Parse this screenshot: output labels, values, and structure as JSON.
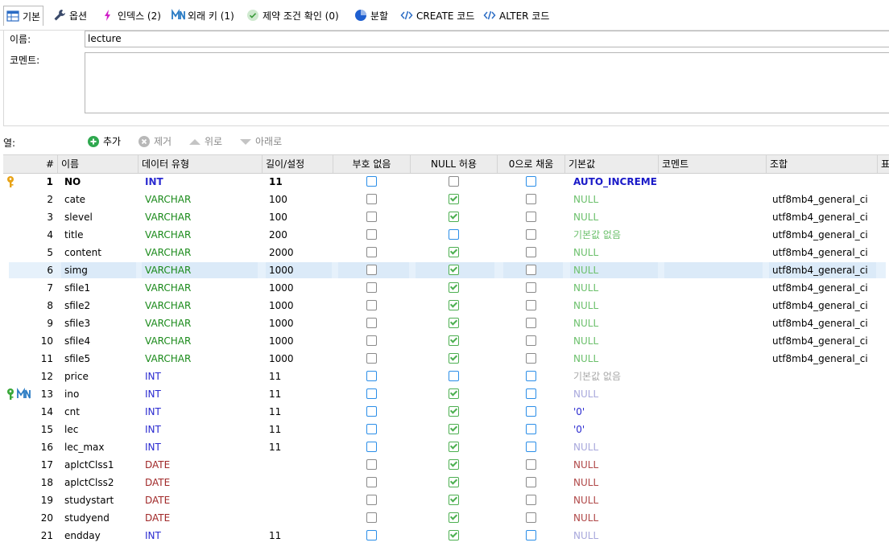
{
  "tabs": [
    {
      "label": "기본",
      "icon": "table-icon",
      "active": true
    },
    {
      "label": "옵션",
      "icon": "wrench-icon"
    },
    {
      "label": "인덱스 (2)",
      "icon": "lightning-icon"
    },
    {
      "label": "외래 키 (1)",
      "icon": "foreign-key-icon"
    },
    {
      "label": "제약 조건 확인 (0)",
      "icon": "check-circle-icon"
    },
    {
      "label": "분할",
      "icon": "pie-icon"
    },
    {
      "label": "CREATE 코드",
      "icon": "code-icon"
    },
    {
      "label": "ALTER 코드",
      "icon": "code-icon"
    }
  ],
  "form": {
    "name_label": "이름:",
    "name_value": "lecture",
    "comment_label": "코멘트:",
    "comment_value": ""
  },
  "columns_bar": {
    "label": "열:",
    "add": "추가",
    "remove": "제거",
    "up": "위로",
    "down": "아래로"
  },
  "headers": [
    "#",
    "이름",
    "데이터 유형",
    "길이/설정",
    "부호 없음",
    "NULL 허용",
    "0으로 채움",
    "기본값",
    "코멘트",
    "조합",
    "표"
  ],
  "rows": [
    {
      "n": "1",
      "name": "NO",
      "type": "INT",
      "len": "11",
      "uns": "blue",
      "nul": "off",
      "zf": "blue",
      "def": "AUTO_INCREME...",
      "coll": "",
      "key": "primary",
      "def_style": "auto"
    },
    {
      "n": "2",
      "name": "cate",
      "type": "VARCHAR",
      "len": "100",
      "uns": "off",
      "nul": "on",
      "zf": "off",
      "def": "NULL",
      "coll": "utf8mb4_general_ci",
      "def_style": "null-green"
    },
    {
      "n": "3",
      "name": "slevel",
      "type": "VARCHAR",
      "len": "100",
      "uns": "off",
      "nul": "on",
      "zf": "off",
      "def": "NULL",
      "coll": "utf8mb4_general_ci",
      "def_style": "null-green"
    },
    {
      "n": "4",
      "name": "title",
      "type": "VARCHAR",
      "len": "200",
      "uns": "off",
      "nul": "blue",
      "zf": "off",
      "def": "기본값 없음",
      "coll": "utf8mb4_general_ci",
      "def_style": "none-green"
    },
    {
      "n": "5",
      "name": "content",
      "type": "VARCHAR",
      "len": "2000",
      "uns": "off",
      "nul": "on",
      "zf": "off",
      "def": "NULL",
      "coll": "utf8mb4_general_ci",
      "def_style": "null-green"
    },
    {
      "n": "6",
      "name": "simg",
      "type": "VARCHAR",
      "len": "1000",
      "uns": "off",
      "nul": "on",
      "zf": "off",
      "def": "NULL",
      "coll": "utf8mb4_general_ci",
      "def_style": "null-green",
      "selected": true
    },
    {
      "n": "7",
      "name": "sfile1",
      "type": "VARCHAR",
      "len": "1000",
      "uns": "off",
      "nul": "on",
      "zf": "off",
      "def": "NULL",
      "coll": "utf8mb4_general_ci",
      "def_style": "null-green"
    },
    {
      "n": "8",
      "name": "sfile2",
      "type": "VARCHAR",
      "len": "1000",
      "uns": "off",
      "nul": "on",
      "zf": "off",
      "def": "NULL",
      "coll": "utf8mb4_general_ci",
      "def_style": "null-green"
    },
    {
      "n": "9",
      "name": "sfile3",
      "type": "VARCHAR",
      "len": "1000",
      "uns": "off",
      "nul": "on",
      "zf": "off",
      "def": "NULL",
      "coll": "utf8mb4_general_ci",
      "def_style": "null-green"
    },
    {
      "n": "10",
      "name": "sfile4",
      "type": "VARCHAR",
      "len": "1000",
      "uns": "off",
      "nul": "on",
      "zf": "off",
      "def": "NULL",
      "coll": "utf8mb4_general_ci",
      "def_style": "null-green"
    },
    {
      "n": "11",
      "name": "sfile5",
      "type": "VARCHAR",
      "len": "1000",
      "uns": "off",
      "nul": "on",
      "zf": "off",
      "def": "NULL",
      "coll": "utf8mb4_general_ci",
      "def_style": "null-green"
    },
    {
      "n": "12",
      "name": "price",
      "type": "INT",
      "len": "11",
      "uns": "blue",
      "nul": "blue",
      "zf": "blue",
      "def": "기본값 없음",
      "coll": "",
      "def_style": "none-grey"
    },
    {
      "n": "13",
      "name": "ino",
      "type": "INT",
      "len": "11",
      "uns": "blue",
      "nul": "on",
      "zf": "blue",
      "def": "NULL",
      "coll": "",
      "key": "foreign",
      "def_style": "null-lav"
    },
    {
      "n": "14",
      "name": "cnt",
      "type": "INT",
      "len": "11",
      "uns": "blue",
      "nul": "on",
      "zf": "blue",
      "def": "'0'",
      "coll": "",
      "def_style": "quote"
    },
    {
      "n": "15",
      "name": "lec",
      "type": "INT",
      "len": "11",
      "uns": "blue",
      "nul": "on",
      "zf": "blue",
      "def": "'0'",
      "coll": "",
      "def_style": "quote"
    },
    {
      "n": "16",
      "name": "lec_max",
      "type": "INT",
      "len": "11",
      "uns": "blue",
      "nul": "on",
      "zf": "blue",
      "def": "NULL",
      "coll": "",
      "def_style": "null-lav"
    },
    {
      "n": "17",
      "name": "aplctClss1",
      "type": "DATE",
      "len": "",
      "uns": "off",
      "nul": "on",
      "zf": "off",
      "def": "NULL",
      "coll": "",
      "def_style": "null-red"
    },
    {
      "n": "18",
      "name": "aplctClss2",
      "type": "DATE",
      "len": "",
      "uns": "off",
      "nul": "on",
      "zf": "off",
      "def": "NULL",
      "coll": "",
      "def_style": "null-red"
    },
    {
      "n": "19",
      "name": "studystart",
      "type": "DATE",
      "len": "",
      "uns": "off",
      "nul": "on",
      "zf": "off",
      "def": "NULL",
      "coll": "",
      "def_style": "null-red"
    },
    {
      "n": "20",
      "name": "studyend",
      "type": "DATE",
      "len": "",
      "uns": "off",
      "nul": "on",
      "zf": "off",
      "def": "NULL",
      "coll": "",
      "def_style": "null-red"
    },
    {
      "n": "21",
      "name": "endday",
      "type": "INT",
      "len": "11",
      "uns": "blue",
      "nul": "on",
      "zf": "blue",
      "def": "NULL",
      "coll": "",
      "def_style": "null-lav"
    }
  ],
  "colors": {
    "varchar": "#1a8a1a",
    "int": "#2a2ad0",
    "date": "#a02828",
    "null_green": "#6cc06c",
    "null_lav": "#a8a8dc",
    "null_red": "#b04848",
    "none_grey": "#a8a8a8",
    "auto": "#1a1ac8",
    "quote": "#2a2ad0",
    "selected_row": "#e6f1fb"
  }
}
